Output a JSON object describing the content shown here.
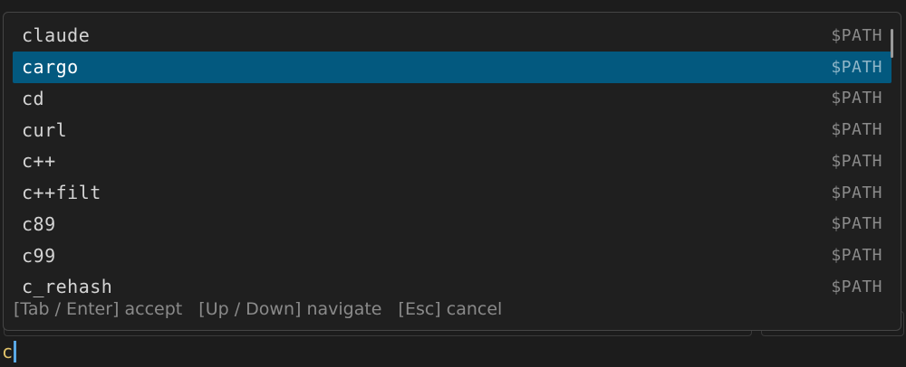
{
  "completion": {
    "items": [
      {
        "name": "claude",
        "source": "$PATH",
        "selected": false
      },
      {
        "name": "cargo",
        "source": "$PATH",
        "selected": true
      },
      {
        "name": "cd",
        "source": "$PATH",
        "selected": false
      },
      {
        "name": "curl",
        "source": "$PATH",
        "selected": false
      },
      {
        "name": "c++",
        "source": "$PATH",
        "selected": false
      },
      {
        "name": "c++filt",
        "source": "$PATH",
        "selected": false
      },
      {
        "name": "c89",
        "source": "$PATH",
        "selected": false
      },
      {
        "name": "c99",
        "source": "$PATH",
        "selected": false
      },
      {
        "name": "c_rehash",
        "source": "$PATH",
        "selected": false
      }
    ],
    "hints": {
      "accept": "[Tab / Enter] accept",
      "navigate": "[Up / Down] navigate",
      "cancel": "[Esc] cancel"
    }
  },
  "prompt": {
    "input": "c"
  },
  "colors": {
    "background": "#1c1c1c",
    "selected_row": "#03597f",
    "cursor": "#5aa9e6",
    "input_text": "#e0c26a"
  }
}
